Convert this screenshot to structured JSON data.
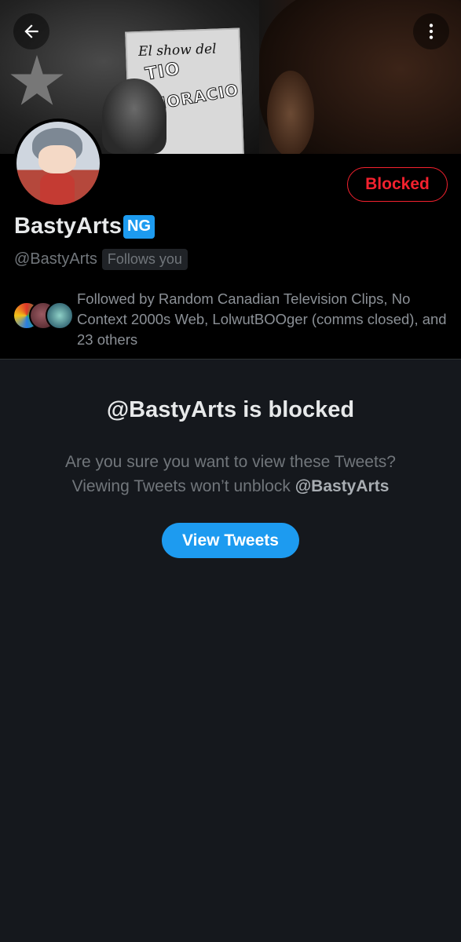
{
  "profile": {
    "display_name": "BastyArts",
    "badge_label": "NG",
    "handle": "@BastyArts",
    "follows_you_label": "Follows you",
    "blocked_button_label": "Blocked",
    "followed_by": {
      "prefix": "Followed by ",
      "names": "Random Canadian Television Clips, No Context 2000s Web, LolwutBOOger (comms closed),",
      "suffix": " and 23 others"
    }
  },
  "banner": {
    "poster_line1": "El show del",
    "poster_line2": "TIO",
    "poster_line3": "HORACIO"
  },
  "blocked_notice": {
    "title": "@BastyArts is blocked",
    "line1": "Are you sure you want to view these Tweets?",
    "line2_prefix": "Viewing Tweets won’t unblock ",
    "line2_handle": "@BastyArts",
    "button_label": "View Tweets"
  },
  "icons": {
    "back": "arrow-left-icon",
    "more": "more-vertical-icon"
  },
  "colors": {
    "accent": "#1d9bf0",
    "blocked_red": "#f4212e",
    "background": "#15181d",
    "header_bg": "#000000"
  }
}
